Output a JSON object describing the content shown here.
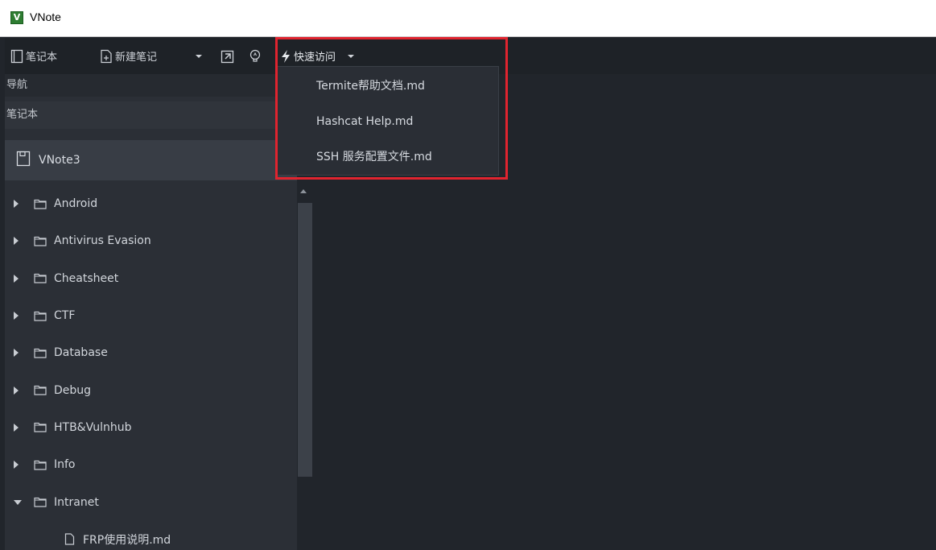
{
  "window": {
    "title": "VNote",
    "logo_letter": "V"
  },
  "toolbar": {
    "notebook_label": "笔记本",
    "new_note_label": "新建笔记",
    "quick_access_label": "快速访问"
  },
  "sidebar": {
    "nav_header": "导航",
    "notebook_header": "笔记本",
    "current_notebook": "VNote3",
    "tree": [
      {
        "label": "Android",
        "type": "folder",
        "expanded": false
      },
      {
        "label": "Antivirus Evasion",
        "type": "folder",
        "expanded": false
      },
      {
        "label": "Cheatsheet",
        "type": "folder",
        "expanded": false
      },
      {
        "label": "CTF",
        "type": "folder",
        "expanded": false
      },
      {
        "label": "Database",
        "type": "folder",
        "expanded": false
      },
      {
        "label": "Debug",
        "type": "folder",
        "expanded": false
      },
      {
        "label": "HTB&Vulnhub",
        "type": "folder",
        "expanded": false
      },
      {
        "label": "Info",
        "type": "folder",
        "expanded": false
      },
      {
        "label": "Intranet",
        "type": "folder",
        "expanded": true
      },
      {
        "label": "FRP使用说明.md",
        "type": "file"
      }
    ]
  },
  "quick_access_menu": {
    "items": [
      {
        "label": "Termite帮助文档.md"
      },
      {
        "label": "Hashcat Help.md"
      },
      {
        "label": "SSH 服务配置文件.md"
      }
    ]
  },
  "colors": {
    "highlight": "#e0242f",
    "background": "#21252b",
    "panel": "#2b2f36"
  }
}
